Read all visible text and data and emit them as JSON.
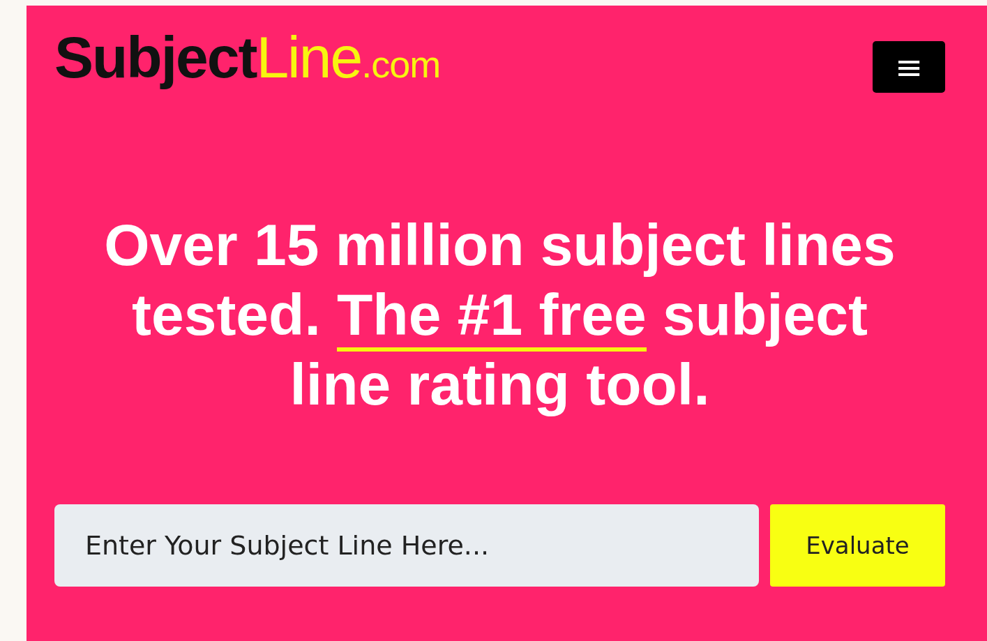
{
  "logo": {
    "bold": "Subject",
    "light": "Line",
    "suffix": ".com"
  },
  "menu_button": {
    "label": "≡"
  },
  "headline": {
    "before": "Over 15 million subject lines tested. ",
    "underlined": "The #1 free",
    "after": " subject line rating tool."
  },
  "form": {
    "placeholder": "Enter Your Subject Line Here...",
    "button": "Evaluate"
  }
}
